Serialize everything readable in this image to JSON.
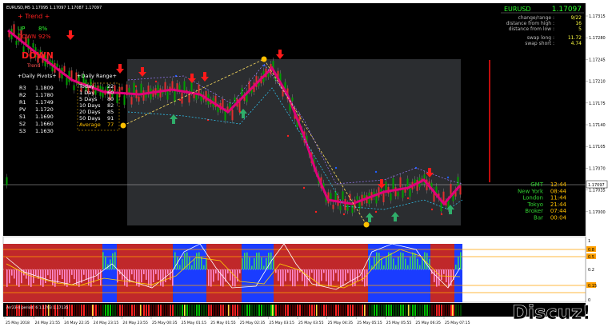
{
  "symbol_header": "EURUSD,M5  1.17095 1.17097 1.17087 1.17097",
  "trend": {
    "title": "+  Trend  +",
    "up_label": "UP",
    "up_value": "8%",
    "down_label": "DOWN",
    "down_value": "92%",
    "big_label": "DOWN",
    "sub_label": "Trend"
  },
  "pivots": {
    "title": "+Daily Pivots+",
    "rows": [
      {
        "label": "R3",
        "value": "1.1809"
      },
      {
        "label": "R2",
        "value": "1.1780"
      },
      {
        "label": "R1",
        "value": "1.1749"
      },
      {
        "label": "PV",
        "value": "1.1720"
      },
      {
        "label": "S1",
        "value": "1.1690"
      },
      {
        "label": "S2",
        "value": "1.1660"
      },
      {
        "label": "S3",
        "value": "1.1630"
      }
    ]
  },
  "range": {
    "title": "+Daily Range+",
    "rows": [
      {
        "label": "Today",
        "value": "22"
      },
      {
        "label": "1 Day",
        "value": "60"
      },
      {
        "label": "5 Days",
        "value": "80"
      },
      {
        "label": "10 Days",
        "value": "82"
      },
      {
        "label": "20 Days",
        "value": "85"
      },
      {
        "label": "50 Days",
        "value": "91"
      },
      {
        "label": "Average",
        "value": "77"
      }
    ]
  },
  "info_panel": {
    "symbol": "EURUSD",
    "price": "1.17097",
    "rows": [
      {
        "label": "change/range :",
        "value": "9/22"
      },
      {
        "label": "distance from high :",
        "value": "16"
      },
      {
        "label": "distance from low :",
        "value": "5"
      }
    ],
    "swaps": [
      {
        "label": "swap long :",
        "value": "11.72"
      },
      {
        "label": "swap short :",
        "value": "4.74"
      }
    ]
  },
  "clock": [
    {
      "label": "GMT",
      "value": "12:44"
    },
    {
      "label": "New York",
      "value": "08:44"
    },
    {
      "label": "London",
      "value": "11:44"
    },
    {
      "label": "Tokyo",
      "value": "21:44"
    },
    {
      "label": "Broker",
      "value": "07:44"
    },
    {
      "label": "Bar",
      "value": "00:04"
    }
  ],
  "price_axis": [
    "1.17315",
    "1.17280",
    "1.17245",
    "1.17210",
    "1.17175",
    "1.17140",
    "1.17105",
    "1.17070",
    "1.17035",
    "1.17000"
  ],
  "current_price_tag": "1.17097",
  "indicator_header": "BBands Stop BAR (10,1) 1.17072 -1.00000 -1.00000 -1.00000 1.17072  RSI_Divergence(7) 18.57/11.74 0.0000000 18.57/11.74  Laguerre 0.8533",
  "indicator_axis": [
    "1",
    "0.8",
    "0.5",
    "0.2",
    "0.15",
    "0"
  ],
  "bottom_header": "Arr23-4 period: 6 1.1703 1.17135",
  "time_axis": [
    "25 May 2018",
    "24 May 21:55",
    "24 May 22:35",
    "24 May 23:15",
    "24 May 23:55",
    "25 May 00:35",
    "25 May 01:15",
    "25 May 01:55",
    "25 May 02:35",
    "25 May 03:15",
    "25 May 03:55",
    "25 May 04:35",
    "25 May 05:15",
    "25 May 05:55",
    "25 May 06:35",
    "25 May 07:15"
  ],
  "watermark": "Discuz!",
  "colors": {
    "background": "#000000",
    "session_box": "#2b2d30",
    "bull": "#00a000",
    "bear": "#e03030",
    "ma": "#e0007a",
    "bband_red": "#c0282a",
    "bband_blue": "#1a3cff",
    "gold": "#ffc000"
  }
}
